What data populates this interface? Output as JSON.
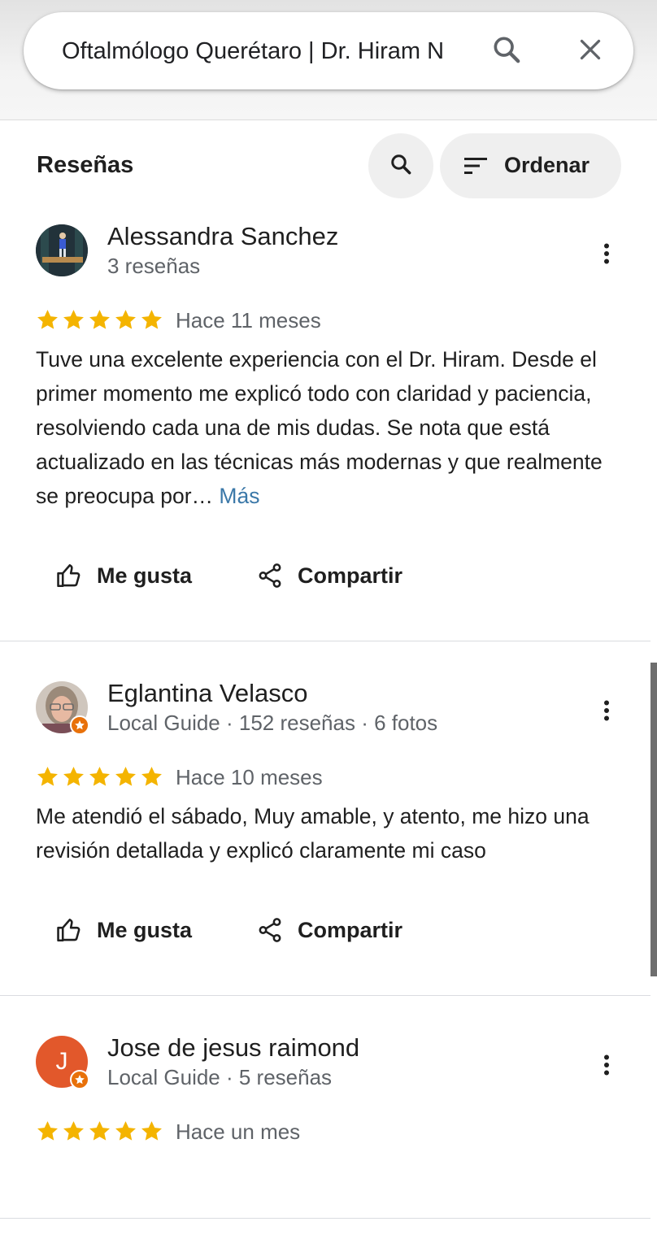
{
  "search": {
    "query": "Oftalmólogo Querétaro | Dr. Hiram N",
    "search_icon": "search-icon",
    "close_icon": "close-icon"
  },
  "reviews_header": {
    "title": "Reseñas",
    "search_icon": "search-icon",
    "sort_label": "Ordenar",
    "sort_icon": "sort-icon"
  },
  "colors": {
    "star": "#f4b400",
    "badge": "#e8710a",
    "more_link": "#3b78a8",
    "initial_avatar": "#e2582b"
  },
  "reviews": [
    {
      "author": "Alessandra Sanchez",
      "meta": "3 reseñas",
      "rating": 5,
      "time": "Hace 11 meses",
      "text": "Tuve una excelente experiencia con el Dr. Hiram. Desde el primer momento me explicó todo con claridad y paciencia, resolviendo cada una de mis dudas. Se nota que está actualizado en las técnicas más modernas y que realmente se preocupa por…",
      "more": "Más",
      "like_label": "Me gusta",
      "share_label": "Compartir"
    },
    {
      "author": "Eglantina Velasco",
      "meta": "Local Guide · 152 reseñas · 6 fotos",
      "rating": 5,
      "time": "Hace 10 meses",
      "text": "Me atendió el sábado, Muy amable, y atento, me hizo una revisión detallada y explicó claramente mi caso",
      "like_label": "Me gusta",
      "share_label": "Compartir"
    },
    {
      "author": "Jose de jesus raimond",
      "initial": "J",
      "meta": "Local Guide · 5 reseñas",
      "rating": 5,
      "time": "Hace un mes"
    }
  ]
}
